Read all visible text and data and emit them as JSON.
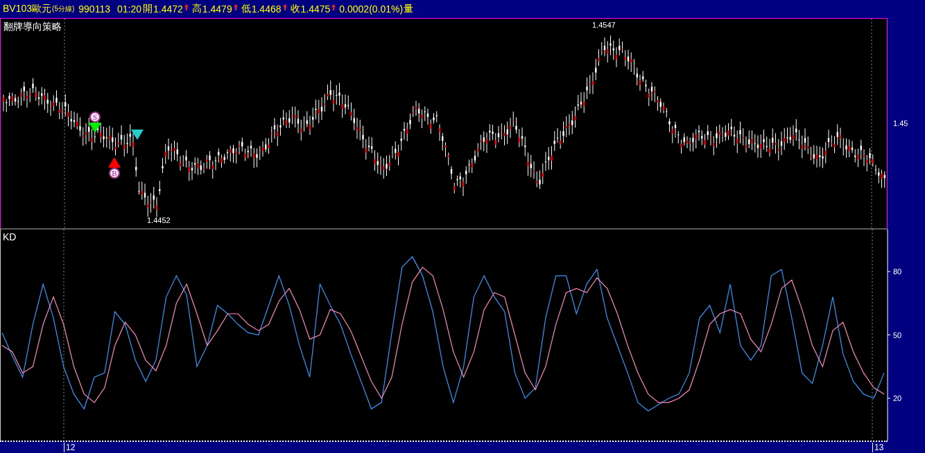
{
  "header": {
    "symbol": "BV103歐元",
    "period": "(5分線)",
    "date": "990113",
    "time": "01:20",
    "quotes": [
      {
        "label": "開",
        "value": "1.4472",
        "rising": true
      },
      {
        "label": "高",
        "value": "1.4479",
        "rising": true
      },
      {
        "label": "低",
        "value": "1.4468",
        "rising": true
      },
      {
        "label": "收",
        "value": "1.4475",
        "rising": true
      }
    ],
    "change": "0.0002(0.01%)",
    "volume_label": "量"
  },
  "price_pane": {
    "title": "翻牌導向策略",
    "high_label": "1.4547",
    "low_label": "1.4452",
    "y_tick": "1.45",
    "signals": [
      {
        "kind": "sell",
        "label": "S"
      },
      {
        "kind": "buy",
        "label": "B"
      },
      {
        "kind": "exit"
      }
    ]
  },
  "kd_pane": {
    "chart_data": {
      "type": "line",
      "title": "KD",
      "ylim": [
        0,
        100
      ],
      "yticks": [
        80,
        50,
        20
      ],
      "categories": [
        null,
        null,
        null,
        null,
        null,
        null,
        null,
        null,
        null,
        null,
        null,
        null,
        null,
        null,
        null,
        null,
        null,
        null,
        null,
        null,
        null,
        null,
        null,
        null,
        null,
        null,
        null,
        null,
        null,
        null,
        null,
        null,
        null,
        null,
        null,
        null,
        null,
        null,
        null,
        null,
        null,
        null,
        null,
        null,
        null,
        null,
        null,
        null,
        null,
        null,
        null,
        null,
        null,
        null,
        null,
        null,
        null,
        null,
        null,
        null,
        null,
        null,
        null,
        null,
        null,
        null,
        null,
        null,
        null,
        null,
        null,
        null,
        null,
        null,
        null,
        null,
        null,
        null,
        null,
        null,
        null,
        null,
        null,
        null,
        null,
        null,
        null
      ],
      "series": [
        {
          "color": "#3399ff",
          "values": [
            51,
            40,
            30,
            55,
            74,
            58,
            35,
            22,
            15,
            30,
            32,
            61,
            55,
            38,
            28,
            38,
            68,
            78,
            69,
            35,
            45,
            64,
            60,
            55,
            51,
            50,
            64,
            78,
            64,
            45,
            30,
            74,
            64,
            55,
            41,
            28,
            15,
            18,
            51,
            82,
            87,
            78,
            61,
            35,
            18,
            35,
            68,
            78,
            68,
            61,
            32,
            20,
            25,
            58,
            78,
            78,
            60,
            74,
            81,
            58,
            45,
            32,
            18,
            14,
            17,
            20,
            22,
            32,
            58,
            64,
            51,
            74,
            45,
            38,
            45,
            78,
            81,
            58,
            32,
            27,
            45,
            68,
            41,
            28,
            22,
            20,
            32
          ]
        },
        {
          "color": "#ff88bb",
          "values": [
            45,
            42,
            32,
            35,
            55,
            68,
            55,
            35,
            22,
            18,
            25,
            45,
            56,
            50,
            38,
            33,
            45,
            65,
            74,
            60,
            45,
            52,
            60,
            60,
            55,
            52,
            55,
            66,
            72,
            62,
            48,
            50,
            62,
            60,
            52,
            40,
            28,
            20,
            30,
            55,
            75,
            82,
            78,
            62,
            42,
            30,
            42,
            62,
            70,
            68,
            50,
            32,
            24,
            35,
            55,
            70,
            72,
            70,
            77,
            72,
            60,
            45,
            32,
            22,
            18,
            18,
            20,
            24,
            38,
            55,
            60,
            62,
            60,
            48,
            42,
            55,
            72,
            76,
            62,
            45,
            35,
            52,
            56,
            42,
            32,
            25,
            22
          ]
        }
      ]
    }
  },
  "time_axis": {
    "labels": [
      {
        "text": "12"
      },
      {
        "text": "13"
      }
    ]
  }
}
